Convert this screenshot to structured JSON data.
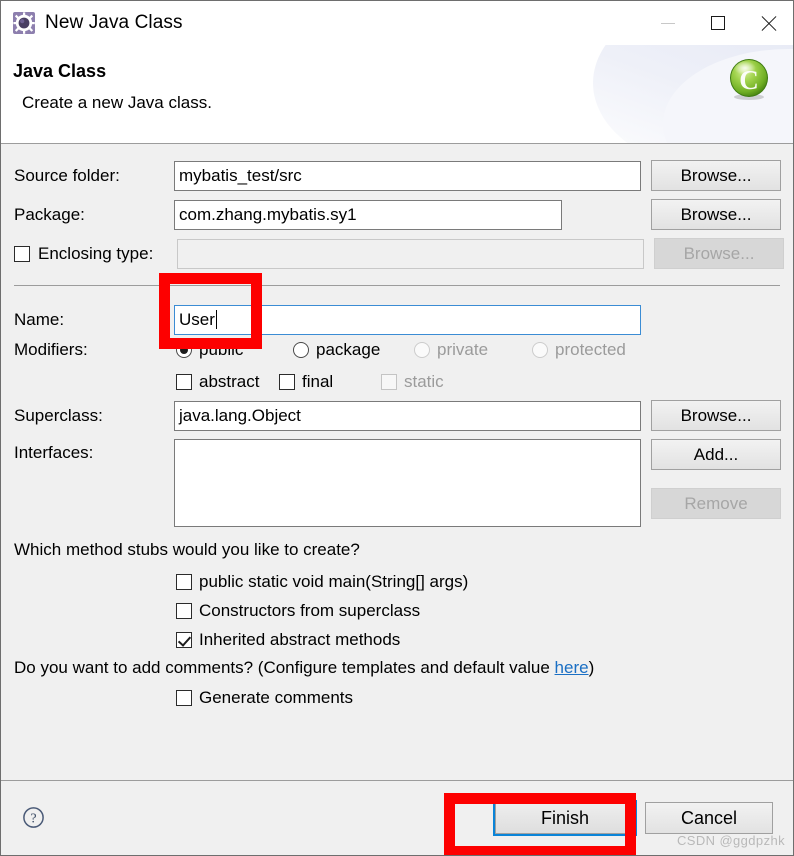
{
  "window": {
    "title": "New Java Class",
    "icon": "wizard-gear-icon",
    "controls": {
      "minimize": "minimize-icon",
      "maximize": "maximize-icon",
      "close": "close-icon"
    }
  },
  "header": {
    "title": "Java Class",
    "subtitle": "Create a new Java class.",
    "banner_icon": "java-class-green-c-icon"
  },
  "form": {
    "source_folder": {
      "label": "Source folder:",
      "value": "mybatis_test/src",
      "button": "Browse..."
    },
    "package": {
      "label": "Package:",
      "value": "com.zhang.mybatis.sy1",
      "button": "Browse..."
    },
    "enclosing_type": {
      "label": "Enclosing type:",
      "checked": false,
      "value": "",
      "button": "Browse...",
      "disabled": true
    },
    "name": {
      "label": "Name:",
      "value": "User",
      "focused": true
    },
    "modifiers": {
      "label": "Modifiers:",
      "access": [
        {
          "label": "public",
          "selected": true,
          "disabled": false
        },
        {
          "label": "package",
          "selected": false,
          "disabled": false
        },
        {
          "label": "private",
          "selected": false,
          "disabled": true
        },
        {
          "label": "protected",
          "selected": false,
          "disabled": true
        }
      ],
      "flags": [
        {
          "label": "abstract",
          "checked": false,
          "disabled": false
        },
        {
          "label": "final",
          "checked": false,
          "disabled": false
        },
        {
          "label": "static",
          "checked": false,
          "disabled": true
        }
      ]
    },
    "superclass": {
      "label": "Superclass:",
      "value": "java.lang.Object",
      "button": "Browse..."
    },
    "interfaces": {
      "label": "Interfaces:",
      "items": [],
      "add_button": "Add...",
      "remove_button": "Remove",
      "remove_disabled": true
    },
    "method_stubs": {
      "question": "Which method stubs would you like to create?",
      "options": [
        {
          "label": "public static void main(String[] args)",
          "checked": false
        },
        {
          "label": "Constructors from superclass",
          "checked": false
        },
        {
          "label": "Inherited abstract methods",
          "checked": true
        }
      ]
    },
    "comments": {
      "question_prefix": "Do you want to add comments? (Configure templates and default value ",
      "link": "here",
      "question_suffix": ")",
      "option": {
        "label": "Generate comments",
        "checked": false
      }
    }
  },
  "footer": {
    "help": "help-icon",
    "finish": "Finish",
    "cancel": "Cancel",
    "watermark": "CSDN @ggdpzhk"
  },
  "annotations": {
    "accent_color": "#fd0000",
    "boxes": [
      {
        "name": "name-field-highlight"
      },
      {
        "name": "finish-button-highlight"
      }
    ]
  }
}
